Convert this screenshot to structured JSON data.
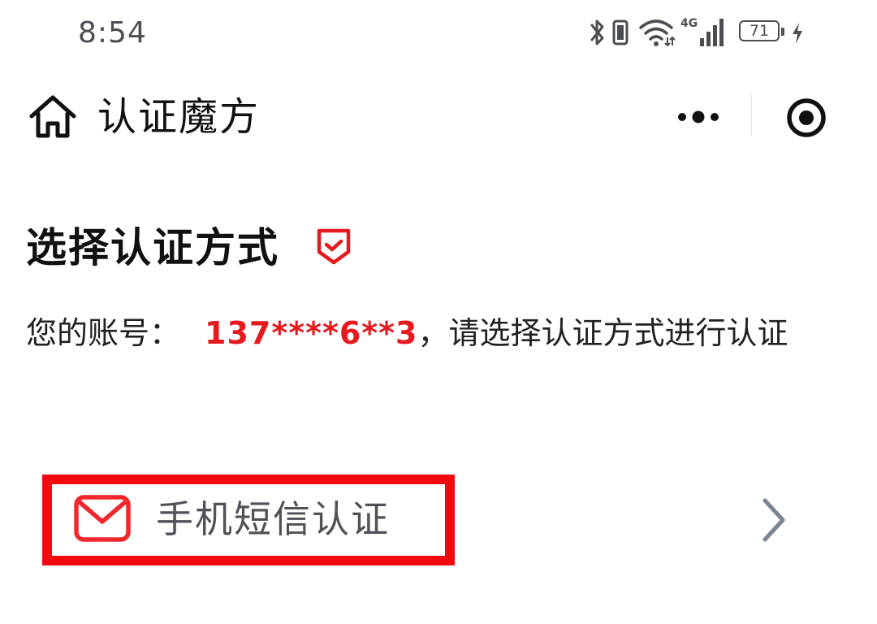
{
  "status_bar": {
    "time": "8:54",
    "network_label": "4G",
    "battery_level": "71",
    "icons": [
      "bluetooth-icon",
      "vibrate-icon",
      "wifi-icon",
      "signal-icon",
      "battery-icon",
      "charging-icon"
    ]
  },
  "nav": {
    "title": "认证魔方",
    "icons": [
      "home-icon",
      "more-icon",
      "close-icon"
    ]
  },
  "content": {
    "section_title": "选择认证方式",
    "account_label": "您的账号：",
    "account_masked": "137****6**3",
    "account_suffix": "，请选择认证方式进行认证"
  },
  "methods": [
    {
      "label": "手机短信认证",
      "icon": "mail-icon"
    }
  ],
  "colors": {
    "accent_red": "#e6191e",
    "highlight_red": "#f20a10",
    "text_dark": "#111111",
    "text_gray": "#4f5257",
    "chevron_gray": "#7a8592"
  }
}
